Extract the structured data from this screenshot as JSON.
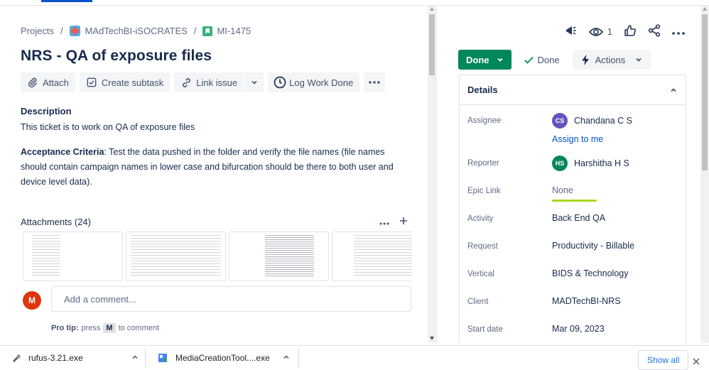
{
  "breadcrumb": {
    "root": "Projects",
    "project": "MAdTechBI-iSOCRATES",
    "issue_key": "MI-1475"
  },
  "issue": {
    "title": "NRS - QA of exposure files"
  },
  "toolbar": {
    "attach": "Attach",
    "create_subtask": "Create subtask",
    "link_issue": "Link issue",
    "log_work": "Log Work Done"
  },
  "description": {
    "label": "Description",
    "text": "This ticket is to work on QA of exposure files",
    "criteria_label": "Acceptance Criteria",
    "criteria_text": ": Test the data pushed in the folder and verify the file names (file names should contain campaign names in lower case and bifurcation should be there to both user and device level data)."
  },
  "attachments": {
    "label": "Attachments (24)"
  },
  "comment": {
    "avatar_initial": "M",
    "placeholder": "Add a comment...",
    "protip_label": "Pro tip:",
    "protip_press": "press",
    "protip_key": "M",
    "protip_suffix": "to comment"
  },
  "header_actions": {
    "watch_count": "1"
  },
  "status": {
    "button": "Done",
    "resolution": "Done",
    "actions": "Actions"
  },
  "details": {
    "title": "Details",
    "assignee_label": "Assignee",
    "assignee_initials": "CS",
    "assignee_name": "Chandana C S",
    "assign_to_me": "Assign to me",
    "reporter_label": "Reporter",
    "reporter_initials": "HS",
    "reporter_name": "Harshitha H S",
    "epic_label": "Epic Link",
    "epic_value": "None",
    "activity_label": "Activity",
    "activity_value": "Back End QA",
    "request_label": "Request",
    "request_value": "Productivity - Billable",
    "vertical_label": "Vertical",
    "vertical_value": "BIDS & Technology",
    "client_label": "Client",
    "client_value": "MADTechBI-NRS",
    "start_label": "Start date",
    "start_value": "Mar 09, 2023"
  },
  "downloads": {
    "item1": "rufus-3.21.exe",
    "item2": "MediaCreationTool....exe",
    "show_all": "Show all"
  },
  "colors": {
    "done_green": "#00875a",
    "link_blue": "#0052cc",
    "assignee_avatar": "#6554c0",
    "reporter_avatar": "#00875a",
    "comment_avatar": "#de350b"
  }
}
